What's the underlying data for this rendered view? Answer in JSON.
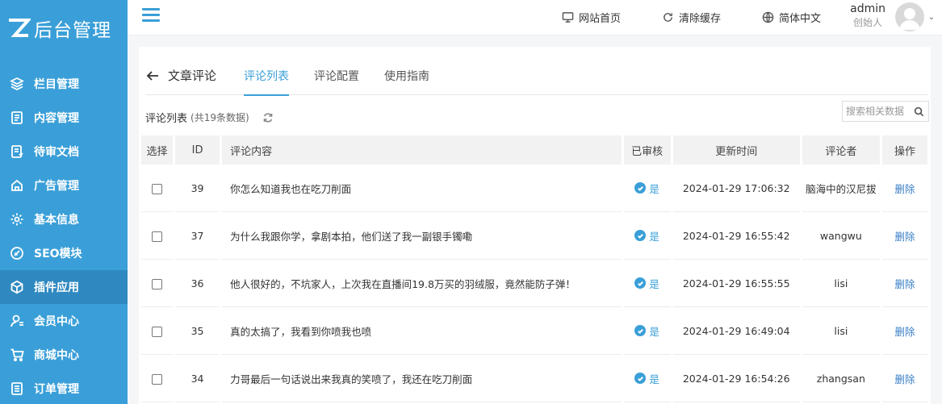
{
  "app": {
    "logo_letter": "Z",
    "logo_text": "后台管理"
  },
  "sidebar": {
    "items": [
      {
        "label": "栏目管理",
        "icon": "layers-icon"
      },
      {
        "label": "内容管理",
        "icon": "document-icon"
      },
      {
        "label": "待审文档",
        "icon": "pending-doc-icon"
      },
      {
        "label": "广告管理",
        "icon": "ad-icon"
      },
      {
        "label": "基本信息",
        "icon": "gear-icon"
      },
      {
        "label": "SEO模块",
        "icon": "seo-icon"
      },
      {
        "label": "插件应用",
        "icon": "cube-icon",
        "active": true
      },
      {
        "label": "会员中心",
        "icon": "user-icon"
      },
      {
        "label": "商城中心",
        "icon": "cart-icon"
      },
      {
        "label": "订单管理",
        "icon": "order-icon"
      }
    ]
  },
  "topbar": {
    "home_label": "网站首页",
    "clear_cache_label": "清除缓存",
    "language_label": "简体中文",
    "user_name": "admin",
    "user_role": "创始人"
  },
  "page": {
    "back_label": "文章评论",
    "tabs": [
      "评论列表",
      "评论配置",
      "使用指南"
    ],
    "active_tab": 0,
    "list_title": "评论列表",
    "list_count": "(共19条数据)",
    "search_placeholder": "搜索相关数据"
  },
  "table": {
    "headers": [
      "选择",
      "ID",
      "评论内容",
      "已审核",
      "更新时间",
      "评论者",
      "操作"
    ],
    "rows": [
      {
        "id": "39",
        "content": "你怎么知道我也在吃刀削面",
        "approved": "是",
        "time": "2024-01-29 17:06:32",
        "author": "脑海中的汉尼拔",
        "action": "删除"
      },
      {
        "id": "37",
        "content": "为什么我跟你学，拿剧本拍，他们送了我一副银手镯嘞",
        "approved": "是",
        "time": "2024-01-29 16:55:42",
        "author": "wangwu",
        "action": "删除"
      },
      {
        "id": "36",
        "content": "他人很好的，不坑家人，上次我在直播间19.8万买的羽绒服，竟然能防子弹！",
        "approved": "是",
        "time": "2024-01-29 16:55:55",
        "author": "lisi",
        "action": "删除"
      },
      {
        "id": "35",
        "content": "真的太搞了，我看到你喷我也喷",
        "approved": "是",
        "time": "2024-01-29 16:49:04",
        "author": "lisi",
        "action": "删除"
      },
      {
        "id": "34",
        "content": "力哥最后一句话说出来我真的笑喷了，我还在吃刀削面",
        "approved": "是",
        "time": "2024-01-29 16:54:26",
        "author": "zhangsan",
        "action": "删除"
      }
    ]
  },
  "colors": {
    "primary": "#3a9fd8",
    "sidebar_active": "#2f89c0",
    "link": "#3a7fc6"
  }
}
